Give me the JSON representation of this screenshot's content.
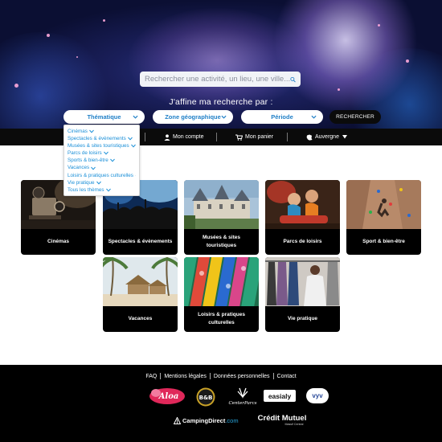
{
  "search": {
    "placeholder": "Rechercher une activité, un lieu, une ville..."
  },
  "refine_title": "J'affine ma recherche par :",
  "filters": [
    {
      "label": "Thématique"
    },
    {
      "label": "Zone géographique"
    },
    {
      "label": "Période"
    }
  ],
  "search_button": "RECHERCHER",
  "nav": {
    "account": "Mon compte",
    "cart": "Mon panier",
    "region": "Auvergne"
  },
  "dropdown_options": [
    "Cinémas",
    "Spectacles & évènements",
    "Musées & sites touristiques",
    "Parcs de loisirs",
    "Sports & bien-être",
    "Vacances",
    "Loisirs & pratiques culturelles",
    "Vie pratique",
    "Tous les thèmes"
  ],
  "cards": [
    {
      "label": "Cinémas"
    },
    {
      "label": "Spectacles & évènements"
    },
    {
      "label": "Musées & sites touristiques"
    },
    {
      "label": "Parcs de loisirs"
    },
    {
      "label": "Sport & bien-être"
    },
    {
      "label": "Vacances"
    },
    {
      "label": "Loisirs & pratiques culturelles"
    },
    {
      "label": "Vie pratique"
    }
  ],
  "footer": {
    "links": [
      "FAQ",
      "Mentions légales",
      "Données personnelles",
      "Contact"
    ],
    "logos": {
      "aloa": "Aloa",
      "bb": "B&B",
      "center_parcs": "CenterParcs",
      "easialy": "easialy",
      "vyv": "vyv",
      "camping_direct": "CampingDirect",
      "camping_direct_tld": ".com",
      "credit_mutuel": "Crédit Mutuel",
      "credit_mutuel_sub": "Massif Central"
    }
  },
  "colors": {
    "accent_blue": "#1f7fc7",
    "dropdown_blue": "#1a8fd8",
    "dark": "#0b0b0b"
  }
}
